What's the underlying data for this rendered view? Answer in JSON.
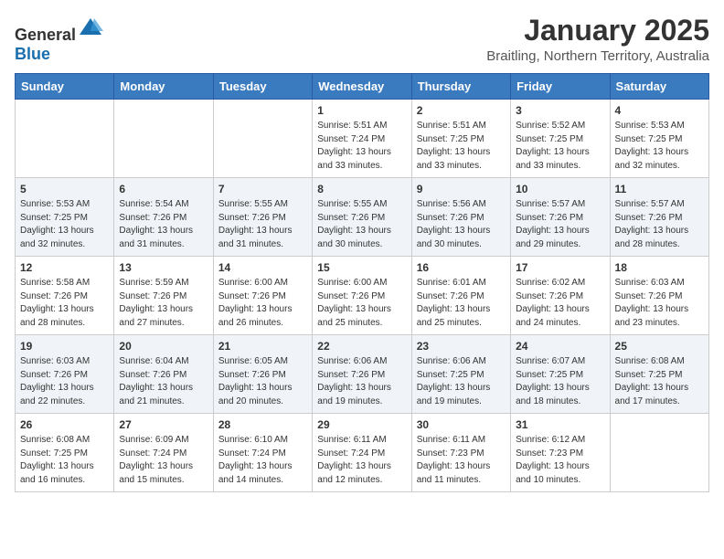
{
  "header": {
    "logo_general": "General",
    "logo_blue": "Blue",
    "month_year": "January 2025",
    "location": "Braitling, Northern Territory, Australia"
  },
  "weekdays": [
    "Sunday",
    "Monday",
    "Tuesday",
    "Wednesday",
    "Thursday",
    "Friday",
    "Saturday"
  ],
  "weeks": [
    [
      {
        "day": "",
        "info": ""
      },
      {
        "day": "",
        "info": ""
      },
      {
        "day": "",
        "info": ""
      },
      {
        "day": "1",
        "info": "Sunrise: 5:51 AM\nSunset: 7:24 PM\nDaylight: 13 hours\nand 33 minutes."
      },
      {
        "day": "2",
        "info": "Sunrise: 5:51 AM\nSunset: 7:25 PM\nDaylight: 13 hours\nand 33 minutes."
      },
      {
        "day": "3",
        "info": "Sunrise: 5:52 AM\nSunset: 7:25 PM\nDaylight: 13 hours\nand 33 minutes."
      },
      {
        "day": "4",
        "info": "Sunrise: 5:53 AM\nSunset: 7:25 PM\nDaylight: 13 hours\nand 32 minutes."
      }
    ],
    [
      {
        "day": "5",
        "info": "Sunrise: 5:53 AM\nSunset: 7:25 PM\nDaylight: 13 hours\nand 32 minutes."
      },
      {
        "day": "6",
        "info": "Sunrise: 5:54 AM\nSunset: 7:26 PM\nDaylight: 13 hours\nand 31 minutes."
      },
      {
        "day": "7",
        "info": "Sunrise: 5:55 AM\nSunset: 7:26 PM\nDaylight: 13 hours\nand 31 minutes."
      },
      {
        "day": "8",
        "info": "Sunrise: 5:55 AM\nSunset: 7:26 PM\nDaylight: 13 hours\nand 30 minutes."
      },
      {
        "day": "9",
        "info": "Sunrise: 5:56 AM\nSunset: 7:26 PM\nDaylight: 13 hours\nand 30 minutes."
      },
      {
        "day": "10",
        "info": "Sunrise: 5:57 AM\nSunset: 7:26 PM\nDaylight: 13 hours\nand 29 minutes."
      },
      {
        "day": "11",
        "info": "Sunrise: 5:57 AM\nSunset: 7:26 PM\nDaylight: 13 hours\nand 28 minutes."
      }
    ],
    [
      {
        "day": "12",
        "info": "Sunrise: 5:58 AM\nSunset: 7:26 PM\nDaylight: 13 hours\nand 28 minutes."
      },
      {
        "day": "13",
        "info": "Sunrise: 5:59 AM\nSunset: 7:26 PM\nDaylight: 13 hours\nand 27 minutes."
      },
      {
        "day": "14",
        "info": "Sunrise: 6:00 AM\nSunset: 7:26 PM\nDaylight: 13 hours\nand 26 minutes."
      },
      {
        "day": "15",
        "info": "Sunrise: 6:00 AM\nSunset: 7:26 PM\nDaylight: 13 hours\nand 25 minutes."
      },
      {
        "day": "16",
        "info": "Sunrise: 6:01 AM\nSunset: 7:26 PM\nDaylight: 13 hours\nand 25 minutes."
      },
      {
        "day": "17",
        "info": "Sunrise: 6:02 AM\nSunset: 7:26 PM\nDaylight: 13 hours\nand 24 minutes."
      },
      {
        "day": "18",
        "info": "Sunrise: 6:03 AM\nSunset: 7:26 PM\nDaylight: 13 hours\nand 23 minutes."
      }
    ],
    [
      {
        "day": "19",
        "info": "Sunrise: 6:03 AM\nSunset: 7:26 PM\nDaylight: 13 hours\nand 22 minutes."
      },
      {
        "day": "20",
        "info": "Sunrise: 6:04 AM\nSunset: 7:26 PM\nDaylight: 13 hours\nand 21 minutes."
      },
      {
        "day": "21",
        "info": "Sunrise: 6:05 AM\nSunset: 7:26 PM\nDaylight: 13 hours\nand 20 minutes."
      },
      {
        "day": "22",
        "info": "Sunrise: 6:06 AM\nSunset: 7:26 PM\nDaylight: 13 hours\nand 19 minutes."
      },
      {
        "day": "23",
        "info": "Sunrise: 6:06 AM\nSunset: 7:25 PM\nDaylight: 13 hours\nand 19 minutes."
      },
      {
        "day": "24",
        "info": "Sunrise: 6:07 AM\nSunset: 7:25 PM\nDaylight: 13 hours\nand 18 minutes."
      },
      {
        "day": "25",
        "info": "Sunrise: 6:08 AM\nSunset: 7:25 PM\nDaylight: 13 hours\nand 17 minutes."
      }
    ],
    [
      {
        "day": "26",
        "info": "Sunrise: 6:08 AM\nSunset: 7:25 PM\nDaylight: 13 hours\nand 16 minutes."
      },
      {
        "day": "27",
        "info": "Sunrise: 6:09 AM\nSunset: 7:24 PM\nDaylight: 13 hours\nand 15 minutes."
      },
      {
        "day": "28",
        "info": "Sunrise: 6:10 AM\nSunset: 7:24 PM\nDaylight: 13 hours\nand 14 minutes."
      },
      {
        "day": "29",
        "info": "Sunrise: 6:11 AM\nSunset: 7:24 PM\nDaylight: 13 hours\nand 12 minutes."
      },
      {
        "day": "30",
        "info": "Sunrise: 6:11 AM\nSunset: 7:23 PM\nDaylight: 13 hours\nand 11 minutes."
      },
      {
        "day": "31",
        "info": "Sunrise: 6:12 AM\nSunset: 7:23 PM\nDaylight: 13 hours\nand 10 minutes."
      },
      {
        "day": "",
        "info": ""
      }
    ]
  ]
}
